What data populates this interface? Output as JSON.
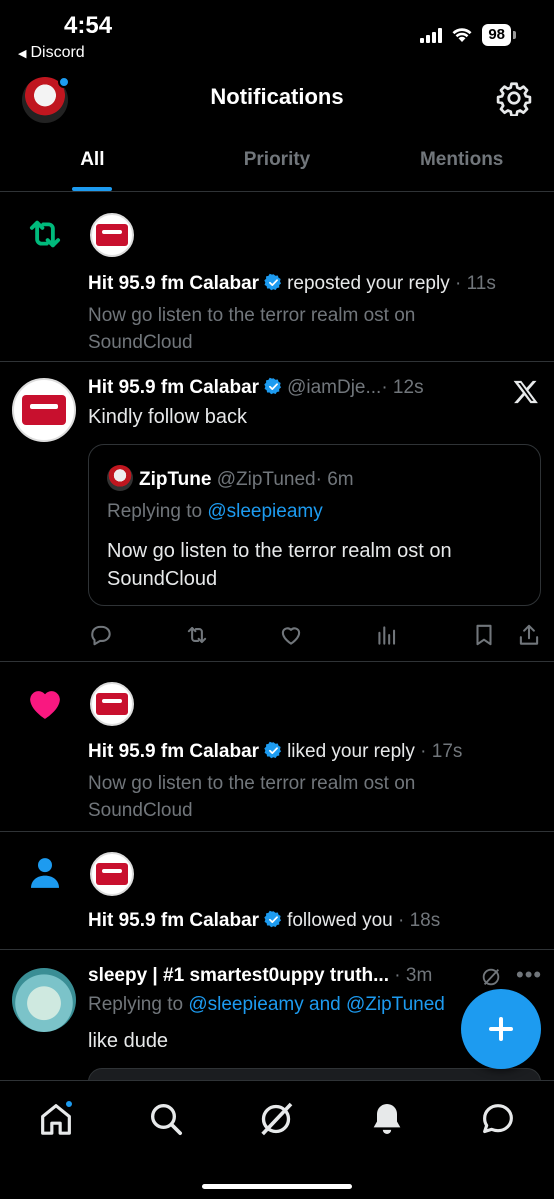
{
  "status_bar": {
    "time": "4:54",
    "back_app": "Discord",
    "battery": "98"
  },
  "header": {
    "title": "Notifications"
  },
  "tabs": [
    {
      "label": "All",
      "active": true
    },
    {
      "label": "Priority",
      "active": false
    },
    {
      "label": "Mentions",
      "active": false
    }
  ],
  "notifications": [
    {
      "type": "repost",
      "icon": "repost-icon",
      "user": "Hit 95.9 fm Calabar",
      "action": "reposted your reply",
      "time": "· 11s",
      "snippet": "Now go listen to the terror realm ost on SoundCloud"
    },
    {
      "type": "reply",
      "user": "Hit 95.9 fm Calabar",
      "handle": "@iamDje...",
      "time": "· 12s",
      "text": "Kindly follow back",
      "quote": {
        "user": "ZipTune",
        "handle": "@ZipTuned",
        "time": "· 6m",
        "replying_label": "Replying to",
        "replying_to": "@sleepieamy",
        "text": "Now go listen to the terror realm ost on SoundCloud"
      }
    },
    {
      "type": "like",
      "icon": "heart-icon",
      "user": "Hit 95.9 fm Calabar",
      "action": "liked your reply",
      "time": "· 17s",
      "snippet": "Now go listen to the terror realm ost on SoundCloud"
    },
    {
      "type": "follow",
      "icon": "person-icon",
      "user": "Hit 95.9 fm Calabar",
      "action": "followed you",
      "time": "· 18s"
    },
    {
      "type": "mention",
      "user": "sleepy | #1 smartest0uppy truth...",
      "time": "· 3m",
      "replying_label": "Replying to",
      "replying_to": "@sleepieamy and @ZipTuned",
      "text": "like dude"
    }
  ],
  "colors": {
    "accent": "#1d9bf0",
    "repost": "#00ba7c",
    "like": "#f91880",
    "muted": "#71767b"
  }
}
